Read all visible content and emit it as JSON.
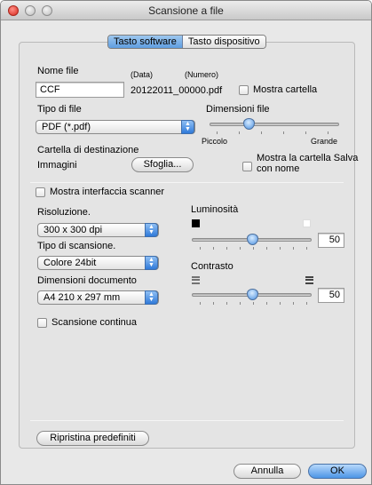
{
  "window": {
    "title": "Scansione a file"
  },
  "tabs": [
    {
      "label": "Tasto software",
      "selected": true
    },
    {
      "label": "Tasto dispositivo",
      "selected": false
    }
  ],
  "file_name": {
    "label": "Nome file",
    "col_data": "(Data)",
    "col_numero": "(Numero)",
    "value": "CCF",
    "generated": "20122011_00000.pdf"
  },
  "show_folder": {
    "label": "Mostra cartella",
    "checked": false
  },
  "file_type": {
    "label": "Tipo di file",
    "value": "PDF (*.pdf)"
  },
  "file_size": {
    "label": "Dimensioni file",
    "min_label": "Piccolo",
    "max_label": "Grande",
    "level": 0.3
  },
  "destination": {
    "label": "Cartella di destinazione",
    "value": "Immagini",
    "browse_button": "Sfoglia..."
  },
  "show_save_as": {
    "label_line1": "Mostra la cartella Salva",
    "label_line2": "con nome",
    "checked": false
  },
  "show_scanner_ui": {
    "label": "Mostra interfaccia scanner",
    "checked": false
  },
  "resolution": {
    "label": "Risoluzione.",
    "value": "300 x 300 dpi"
  },
  "scan_type": {
    "label": "Tipo di scansione.",
    "value": "Colore 24bit"
  },
  "document_size": {
    "label": "Dimensioni documento",
    "value": "A4 210 x 297 mm"
  },
  "continuous_scan": {
    "label": "Scansione continua",
    "checked": false
  },
  "brightness": {
    "label": "Luminosità",
    "value": "50",
    "level": 0.5
  },
  "contrast": {
    "label": "Contrasto",
    "value": "50",
    "level": 0.5
  },
  "restore_button": "Ripristina predefiniti",
  "cancel_button": "Annulla",
  "ok_button": "OK"
}
